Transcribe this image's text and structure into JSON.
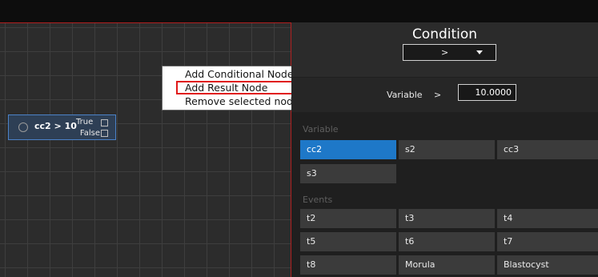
{
  "canvas": {
    "node": {
      "expression": "cc2 > 10",
      "true_label": "True",
      "false_label": "False"
    },
    "context_menu": {
      "items": [
        "Add Conditional Node",
        "Add Result Node",
        "Remove selected nodes"
      ],
      "highlighted_index": 1
    }
  },
  "panel": {
    "title": "Condition",
    "operator_select": {
      "value": ">"
    },
    "variable_row": {
      "label": "Variable",
      "operator": ">",
      "value": "10.0000"
    },
    "variables_section": {
      "label": "Variable",
      "items": [
        "cc2",
        "s2",
        "cc3",
        "s3"
      ],
      "selected": "cc2"
    },
    "events_section": {
      "label": "Events",
      "items": [
        "t2",
        "t3",
        "t4",
        "t5",
        "t6",
        "t7",
        "t8",
        "Morula",
        "Blastocyst"
      ]
    }
  },
  "colors": {
    "selected_tile": "#1e78c8",
    "highlight_border": "#e01919",
    "canvas_border": "#b02020",
    "node_border": "#4b82c8"
  }
}
